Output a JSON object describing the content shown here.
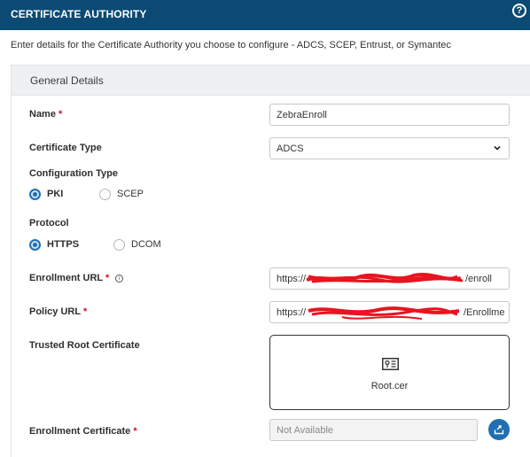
{
  "header": {
    "title": "CERTIFICATE AUTHORITY",
    "help_icon": "question-circle-icon"
  },
  "intro": "Enter details for the Certificate Authority you choose to configure - ADCS, SCEP, Entrust, or Symantec",
  "section": {
    "title": "General Details"
  },
  "required_mark": "*",
  "fields": {
    "name": {
      "label": "Name",
      "value": "ZebraEnroll"
    },
    "cert_type": {
      "label": "Certificate Type",
      "value": "ADCS"
    },
    "config_type": {
      "label": "Configuration Type",
      "options": [
        "PKI",
        "SCEP"
      ],
      "selected": "PKI"
    },
    "protocol": {
      "label": "Protocol",
      "options": [
        "HTTPS",
        "DCOM"
      ],
      "selected": "HTTPS"
    },
    "enroll_url": {
      "label": "Enrollment URL",
      "prefix": "https://",
      "suffix": "/enroll",
      "info_icon": "i"
    },
    "policy_url": {
      "label": "Policy URL",
      "prefix": "https://",
      "suffix": "/Enrollme"
    },
    "trusted_root": {
      "label": "Trusted Root Certificate",
      "file": "Root.cer"
    },
    "enroll_cert": {
      "label": "Enrollment Certificate",
      "value": "Not Available"
    }
  },
  "colors": {
    "header_bg": "#0b4a73",
    "accent": "#1f6fb2",
    "required": "#c8102e",
    "redaction": "#e8141f"
  }
}
